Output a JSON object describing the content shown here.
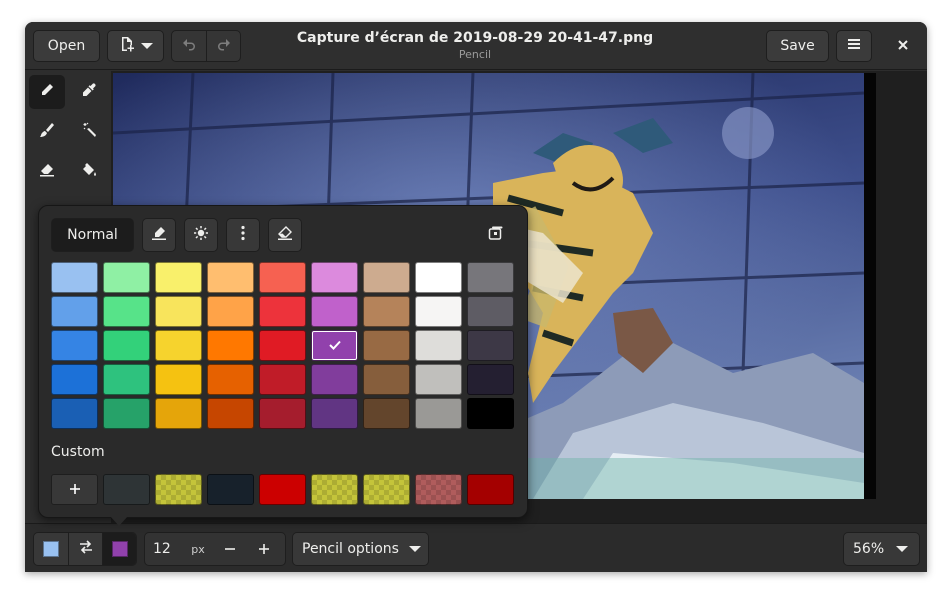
{
  "header": {
    "open_label": "Open",
    "title": "Capture d’écran de 2019-08-29 20-41-47.png",
    "subtitle": "Pencil",
    "save_label": "Save"
  },
  "tools": [
    {
      "name": "pencil",
      "icon": "pencil-icon",
      "active": true
    },
    {
      "name": "color-picker",
      "icon": "eyedropper-icon",
      "active": false
    },
    {
      "name": "paint",
      "icon": "brush-icon",
      "active": false
    },
    {
      "name": "magic",
      "icon": "magic-wand-icon",
      "active": false
    },
    {
      "name": "eraser",
      "icon": "eraser-icon",
      "active": false
    },
    {
      "name": "fill",
      "icon": "paint-bucket-icon",
      "active": false
    }
  ],
  "popover": {
    "blend_mode": "Normal",
    "palette": [
      [
        "#99c1f1",
        "#8ff0a4",
        "#f9f06b",
        "#ffbe6f",
        "#f66151",
        "#dc8add",
        "#cdab8f",
        "#ffffff",
        "#77767b"
      ],
      [
        "#62a0ea",
        "#57e389",
        "#f8e45c",
        "#ffa348",
        "#ed333b",
        "#c061cb",
        "#b5835a",
        "#f6f5f4",
        "#5e5c64"
      ],
      [
        "#3584e4",
        "#33d17a",
        "#f6d32d",
        "#ff7800",
        "#e01b24",
        "#9141ac",
        "#986a44",
        "#deddda",
        "#3d3846"
      ],
      [
        "#1c71d8",
        "#2ec27e",
        "#f5c211",
        "#e66100",
        "#c01c28",
        "#813d9c",
        "#865e3c",
        "#c0bfbc",
        "#241f31"
      ],
      [
        "#1a5fb4",
        "#26a269",
        "#e5a50a",
        "#c64600",
        "#a51d2d",
        "#613583",
        "#63452c",
        "#9a9996",
        "#000000"
      ]
    ],
    "selected_color": "#9141ac",
    "custom_label": "Custom",
    "custom_colors": [
      {
        "color": "#2e3436",
        "transparent": false
      },
      {
        "color": "#c4c43a",
        "transparent": true
      },
      {
        "color": "#17212b",
        "transparent": false
      },
      {
        "color": "#cc0000",
        "transparent": false
      },
      {
        "color": "#c4c43a",
        "transparent": true
      },
      {
        "color": "#c4c43a",
        "transparent": true
      },
      {
        "color": "#b05c5c",
        "transparent": true
      },
      {
        "color": "#a40000",
        "transparent": false
      }
    ]
  },
  "bottombar": {
    "left_color": "#99c1f1",
    "right_color": "#9141ac",
    "size_value": "12",
    "size_unit": "px",
    "options_label": "Pencil options",
    "zoom_label": "56%"
  }
}
